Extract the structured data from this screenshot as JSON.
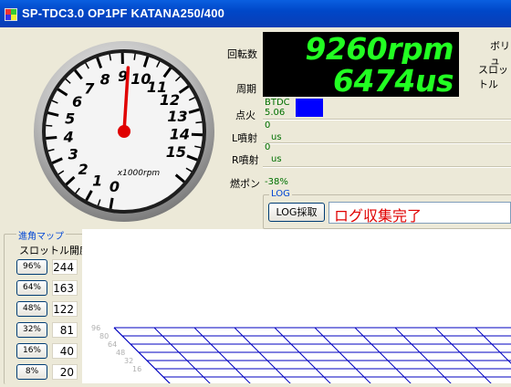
{
  "window": {
    "title": "SP-TDC3.0 OP1PF KATANA250/400"
  },
  "gauge": {
    "labels": [
      "0",
      "1",
      "2",
      "3",
      "4",
      "5",
      "6",
      "7",
      "8",
      "9",
      "10",
      "11",
      "12",
      "13",
      "14",
      "15"
    ],
    "unit": "x1000rpm",
    "needle_value": 9.26,
    "max": 16
  },
  "readouts": {
    "rpm_label": "回転数",
    "rpm_value": "9260rpm",
    "period_label": "周期",
    "period_value": "6474us",
    "ignition_label": "点火",
    "ignition_mode": "BTDC",
    "ignition_value": "5.06",
    "l_inj_label": "L噴射",
    "l_inj_value": "0",
    "l_inj_unit": "us",
    "r_inj_label": "R噴射",
    "r_inj_value": "0",
    "r_inj_unit": "us",
    "fuel_pump_label": "燃ポン",
    "fuel_pump_value": "-38%"
  },
  "side_labels": {
    "volume": "ボリュ",
    "throttle": "スロットル"
  },
  "log": {
    "group_title": "LOG",
    "button": "LOG採取",
    "status": "ログ収集完了"
  },
  "map": {
    "group_title": "進角マップ",
    "throttle_label": "スロットル開度",
    "rows": [
      {
        "throttle": "96%",
        "value": "244"
      },
      {
        "throttle": "64%",
        "value": "163"
      },
      {
        "throttle": "48%",
        "value": "122"
      },
      {
        "throttle": "32%",
        "value": "81"
      },
      {
        "throttle": "16%",
        "value": "40"
      },
      {
        "throttle": "8%",
        "value": "20"
      }
    ],
    "axis_labels": [
      "96",
      "80",
      "64",
      "48",
      "32",
      "16"
    ]
  },
  "colors": {
    "lcd_text": "#22ff22",
    "ignition_box": "#0000ff",
    "log_status": "#e00000",
    "needle": "#e00000",
    "grid": "#0000c0"
  }
}
